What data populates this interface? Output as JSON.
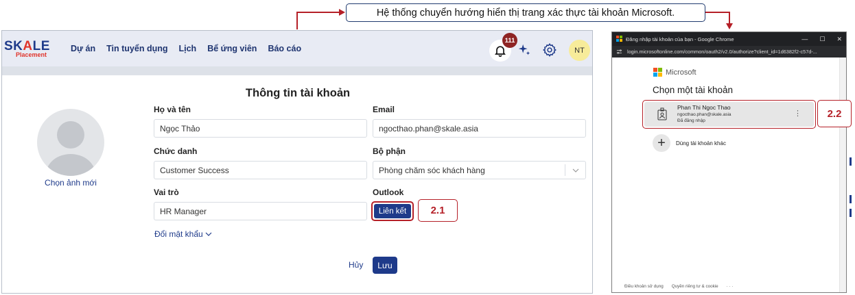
{
  "callout": {
    "text": "Hệ thống chuyển hướng hiển thị trang xác thực tài khoản Microsoft."
  },
  "app": {
    "logo": {
      "main_left": "SK",
      "main_accent": "A",
      "main_right": "LE",
      "sub": "Placement"
    },
    "nav": [
      "Dự án",
      "Tin tuyển dụng",
      "Lịch",
      "Bể ứng viên",
      "Báo cáo"
    ],
    "notification_count": "111",
    "avatar_initials": "NT",
    "page_title": "Thông tin tài khoản",
    "choose_photo": "Chọn ảnh mới",
    "form": {
      "full_name_label": "Họ và tên",
      "full_name_value": "Ngọc Thảo",
      "email_label": "Email",
      "email_value": "ngocthao.phan@skale.asia",
      "title_label": "Chức danh",
      "title_value": "Customer Success",
      "department_label": "Bộ phận",
      "department_value": "Phòng chăm sóc khách hàng",
      "role_label": "Vai trò",
      "role_value": "HR Manager",
      "outlook_label": "Outlook",
      "link_button": "Liên kết",
      "change_password": "Đổi mật khẩu",
      "cancel": "Hủy",
      "save": "Lưu"
    },
    "step_1": "2.1"
  },
  "popup": {
    "window_title": "Đăng nhập tài khoản của bạn - Google Chrome",
    "url": "login.microsoftonline.com/common/oauth2/v2.0/authorize?client_id=1d6382f2-c57d-...",
    "brand": "Microsoft",
    "heading": "Chọn một tài khoản",
    "account": {
      "name": "Phan Thi Ngoc Thao",
      "email": "ngocthao.phan@skale.asia",
      "status": "Đã đăng nhập"
    },
    "other_account": "Dùng tài khoản khác",
    "footer": [
      "Điều khoản sử dụng",
      "Quyền riêng tư & cookie",
      "· · ·"
    ],
    "step_2": "2.2"
  },
  "colors": {
    "brand_blue": "#1e3a8a",
    "annotation_red": "#b51f27",
    "badge": "#8e2424",
    "avatar_bg": "#f7ec9a"
  }
}
